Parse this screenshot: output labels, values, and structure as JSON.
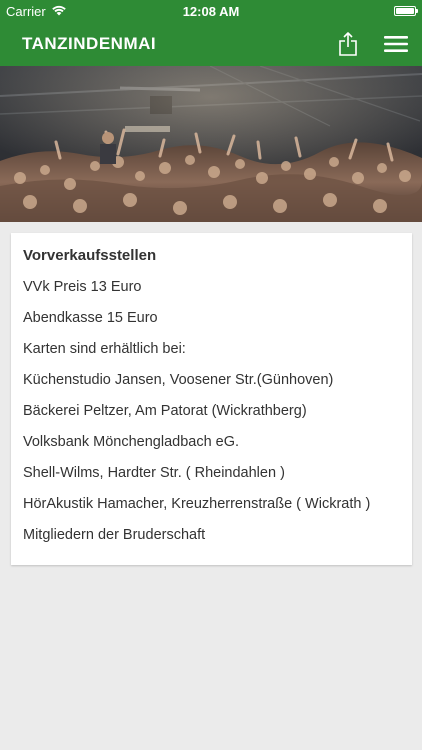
{
  "status_bar": {
    "carrier": "Carrier",
    "time": "12:08 AM"
  },
  "nav": {
    "title": "TANZINDENMAI",
    "share_icon": "share-icon",
    "menu_icon": "hamburger-menu-icon",
    "bg_color": "#2e8b35"
  },
  "hero": {
    "image_subject": "concert crowd with raised hands under stage lights"
  },
  "card": {
    "title": "Vorverkaufsstellen",
    "lines": [
      "VVk Preis 13 Euro",
      "Abendkasse 15 Euro",
      "Karten sind erhältlich bei:",
      "Küchenstudio Jansen, Voosener Str.(Günhoven)",
      "Bäckerei Peltzer, Am Patorat (Wickrathberg)",
      "Volksbank Mönchengladbach eG.",
      "Shell-Wilms, Hardter Str. ( Rheindahlen )",
      "HörAkustik Hamacher, Kreuzherrenstraße ( Wickrath )",
      "Mitgliedern der Bruderschaft"
    ]
  }
}
